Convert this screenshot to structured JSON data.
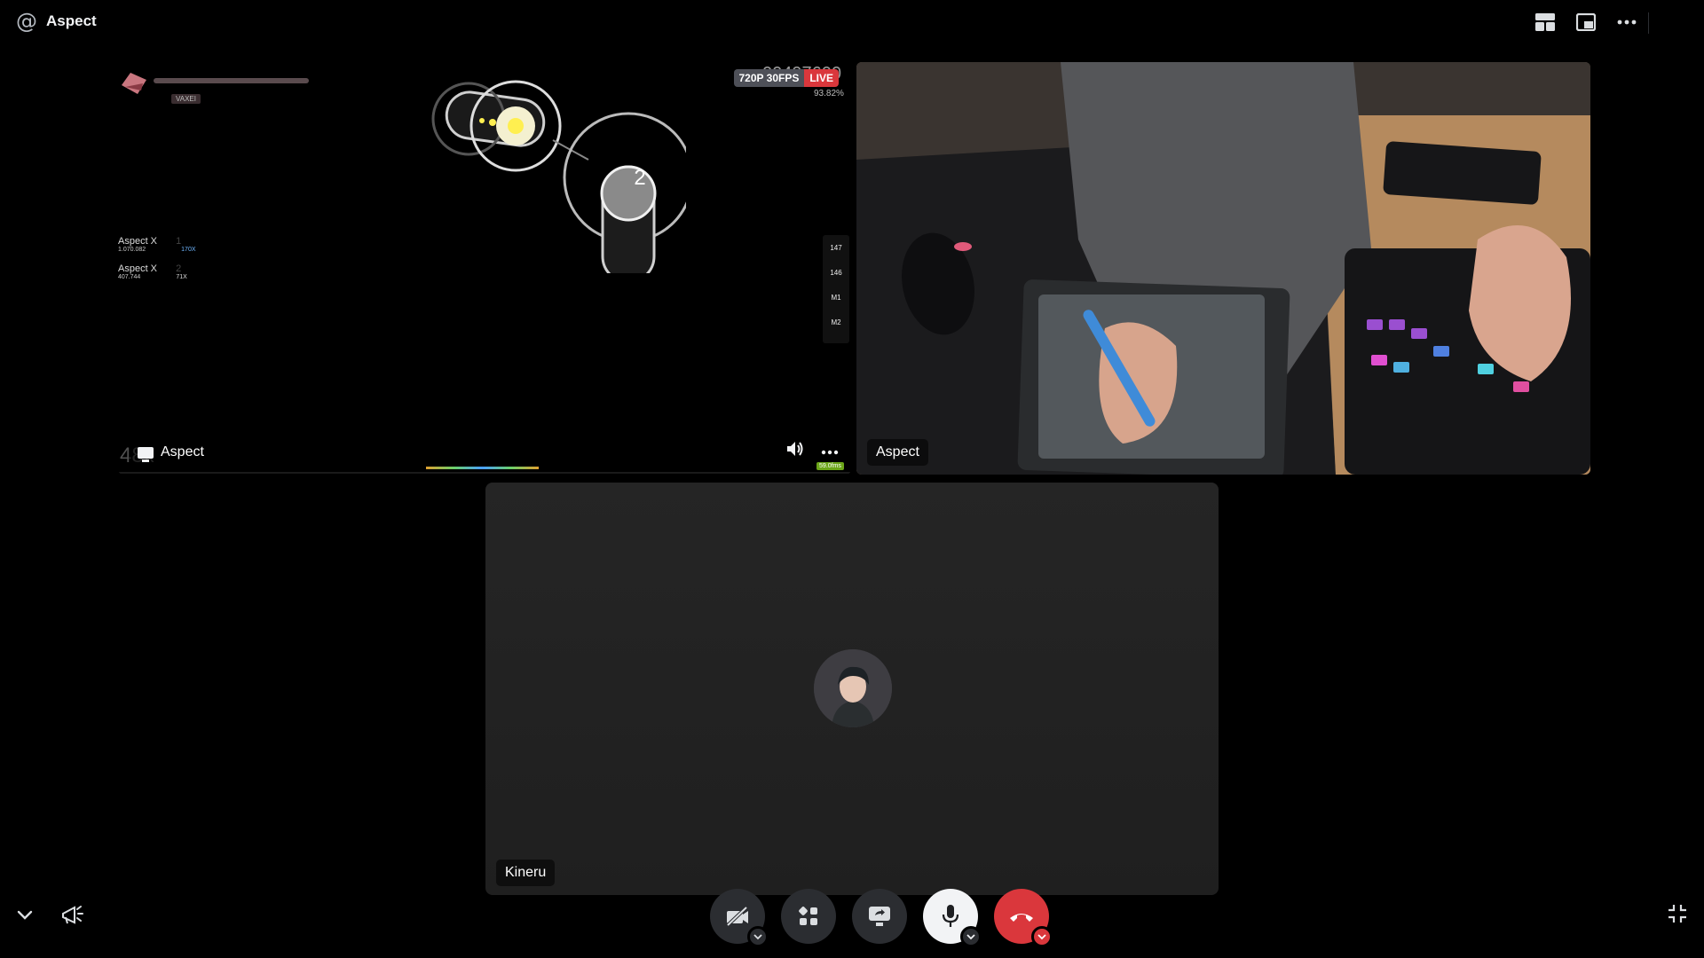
{
  "header": {
    "channel_icon": "at-sign-icon",
    "title": "Aspect",
    "actions": [
      "grid-layout-icon",
      "popout-icon",
      "more-options-icon"
    ]
  },
  "tiles": {
    "stream": {
      "name": "Aspect",
      "quality": "720P 30FPS",
      "live": "LIVE",
      "game": {
        "score": "00497600",
        "accuracy": "93.82%",
        "player_tag": "VAXEI",
        "approach_number": "2",
        "leaderboard": [
          {
            "name": "Aspect X",
            "rank": "1",
            "score": "1.070.082",
            "combo": "170X"
          },
          {
            "name": "Aspect X",
            "rank": "2",
            "score": "407.744",
            "combo": "71X"
          }
        ],
        "keys": [
          "147",
          "146",
          "M1",
          "M2"
        ],
        "combo": "48x",
        "fps": "59.0fms"
      }
    },
    "camera": {
      "name": "Aspect"
    },
    "participant": {
      "name": "Kineru"
    }
  },
  "controls": {
    "camera": "camera-off-icon",
    "activities": "activity-icon",
    "share": "screen-share-icon",
    "mic": "microphone-icon",
    "disconnect": "hang-up-icon"
  },
  "colors": {
    "live": "#da373c",
    "accent": "#f2f3f5",
    "button": "#2b2d31"
  }
}
